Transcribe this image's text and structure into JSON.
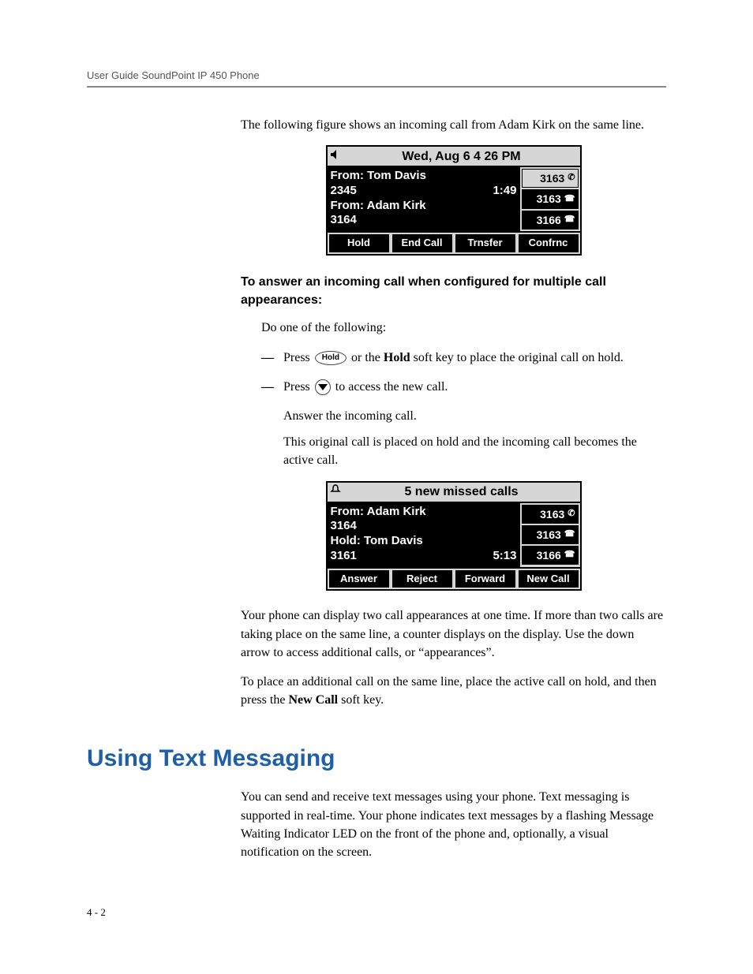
{
  "header": {
    "running": "User Guide SoundPoint IP 450 Phone"
  },
  "intro": {
    "p1": "The following figure shows an incoming call from Adam Kirk on the same line."
  },
  "screen1": {
    "titlebar": "Wed, Aug 6   4 26 PM",
    "main": {
      "l1": "From: Tom Davis",
      "l2_left": "2345",
      "l2_right": "1:49",
      "l3": "From: Adam Kirk",
      "l4": "3164"
    },
    "lines": [
      {
        "num": "3163",
        "style": "light"
      },
      {
        "num": "3163",
        "style": "dark"
      },
      {
        "num": "3166",
        "style": "dark"
      }
    ],
    "softkeys": [
      "Hold",
      "End Call",
      "Trnsfer",
      "Confrnc"
    ]
  },
  "procedure": {
    "heading": "To answer an incoming call when configured for multiple call appearances:",
    "lead": "Do one of the following:",
    "step1_a": "Press ",
    "step1_key": "Hold",
    "step1_b": " or the ",
    "step1_bold": "Hold",
    "step1_c": " soft key to place the original call on hold.",
    "step2_a": "Press ",
    "step2_b": " to access the new call.",
    "sub1": "Answer the incoming call.",
    "sub2": "This original call is placed on hold and the incoming call becomes the active call."
  },
  "screen2": {
    "titlebar": "5 new missed calls",
    "main": {
      "l1": "From: Adam Kirk",
      "l2": "3164",
      "l3": "Hold: Tom Davis",
      "l4_left": "3161",
      "l4_right": "5:13"
    },
    "lines": [
      {
        "num": "3163",
        "style": "dark"
      },
      {
        "num": "3163",
        "style": "dark"
      },
      {
        "num": "3166",
        "style": "dark"
      }
    ],
    "softkeys": [
      "Answer",
      "Reject",
      "Forward",
      "New Call"
    ]
  },
  "after": {
    "p1": "Your phone can display two call appearances at one time. If more than two calls are taking place on the same line, a counter displays on the display. Use the down arrow to access additional calls, or “appearances”.",
    "p2_a": "To place an additional call on the same line, place the active call on hold, and then press the ",
    "p2_bold": "New Call",
    "p2_b": " soft key."
  },
  "section": {
    "title": "Using Text Messaging",
    "p1": "You can send and receive text messages using your phone. Text messaging is supported in real-time. Your phone indicates text messages by a flashing Message Waiting Indicator LED on the front of the phone and, optionally, a visual notification on the screen."
  },
  "footer": {
    "pagenum": "4 - 2"
  }
}
